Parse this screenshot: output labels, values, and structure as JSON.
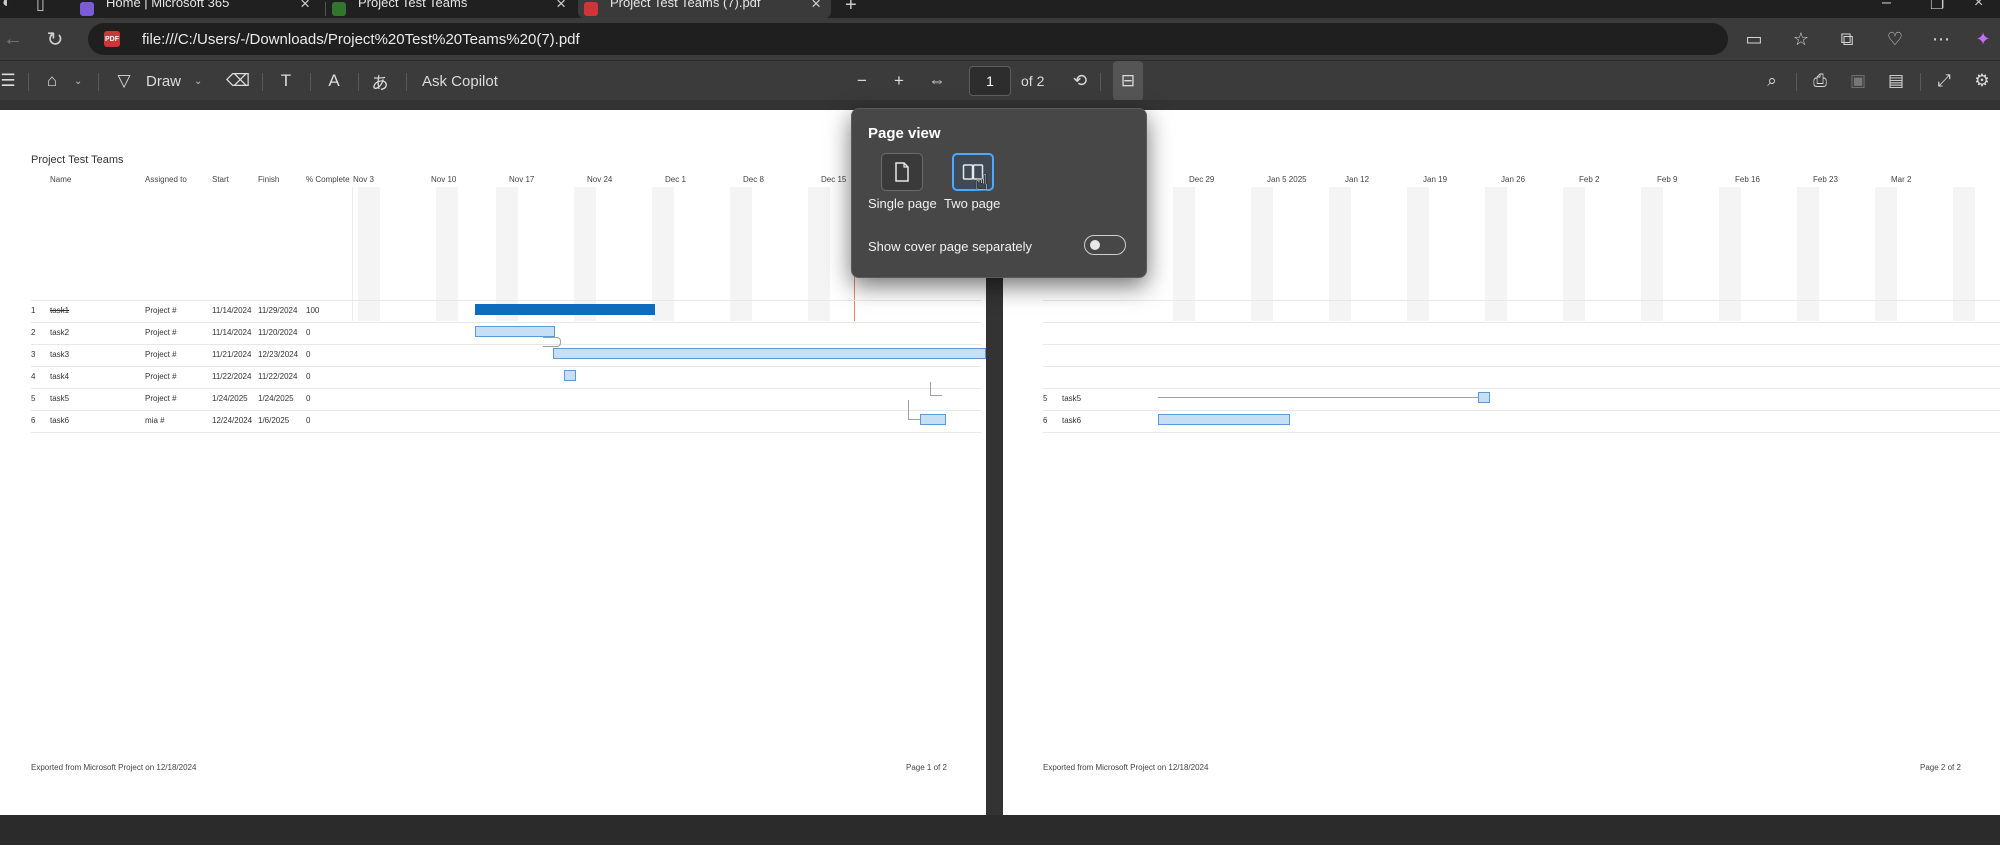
{
  "tabs": [
    {
      "title": "Home | Microsoft 365",
      "icon": "microsoft365-icon",
      "color": "#7b5cd6"
    },
    {
      "title": "Project Test Teams",
      "icon": "project-icon",
      "color": "#31752f"
    },
    {
      "title": "Project Test Teams (7).pdf",
      "icon": "pdf-icon",
      "color": "#d13438"
    }
  ],
  "address": {
    "url": "file:///C:/Users/-/Downloads/Project%20Test%20Teams%20(7).pdf"
  },
  "toolbar": {
    "draw_label": "Draw",
    "ask_copilot_label": "Ask Copilot",
    "page_number": "1",
    "page_total": "of 2"
  },
  "popup": {
    "title": "Page view",
    "single_label": "Single page",
    "two_label": "Two page",
    "cover_label": "Show cover page separately",
    "cover_enabled": false
  },
  "page1": {
    "title": "Project Test Teams",
    "headers": {
      "name": "Name",
      "assigned": "Assigned to",
      "start": "Start",
      "finish": "Finish",
      "complete": "% Complete"
    },
    "timeline": [
      "Nov 3",
      "Nov 10",
      "Nov 17",
      "Nov 24",
      "Dec 1",
      "Dec 8",
      "Dec 15"
    ],
    "rows": [
      {
        "id": "1",
        "name": "task1",
        "assigned": "Project #",
        "start": "11/14/2024",
        "finish": "11/29/2024",
        "complete": "100"
      },
      {
        "id": "2",
        "name": "task2",
        "assigned": "Project #",
        "start": "11/14/2024",
        "finish": "11/20/2024",
        "complete": "0"
      },
      {
        "id": "3",
        "name": "task3",
        "assigned": "Project #",
        "start": "11/21/2024",
        "finish": "12/23/2024",
        "complete": "0"
      },
      {
        "id": "4",
        "name": "task4",
        "assigned": "Project #",
        "start": "11/22/2024",
        "finish": "11/22/2024",
        "complete": "0"
      },
      {
        "id": "5",
        "name": "task5",
        "assigned": "Project #",
        "start": "1/24/2025",
        "finish": "1/24/2025",
        "complete": "0"
      },
      {
        "id": "6",
        "name": "task6",
        "assigned": "mia #",
        "start": "12/24/2024",
        "finish": "1/6/2025",
        "complete": "0"
      }
    ],
    "footer_left": "Exported from Microsoft Project on 12/18/2024",
    "footer_right": "Page 1 of 2"
  },
  "page2": {
    "timeline": [
      "Dec 29",
      "Jan 5 2025",
      "Jan 12",
      "Jan 19",
      "Jan 26",
      "Feb 2",
      "Feb 9",
      "Feb 16",
      "Feb 23",
      "Mar 2"
    ],
    "rows": [
      {
        "id": "5",
        "name": "task5"
      },
      {
        "id": "6",
        "name": "task6"
      }
    ],
    "footer_left": "Exported from Microsoft Project on 12/18/2024",
    "footer_right": "Page 2 of 2"
  }
}
